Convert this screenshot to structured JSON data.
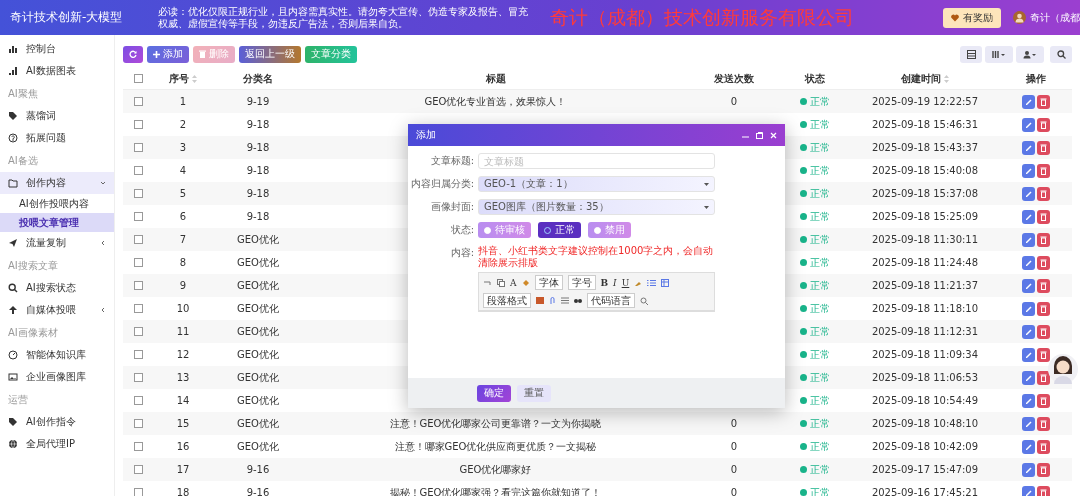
{
  "header": {
    "app_title": "奇计技术创新-大模型",
    "notice": "必读：优化仅限正规行业，且内容需真实性。请勿夸大宣传、伪造专家及报告、冒充权威、虚假宣传等手段，勿违反广告法，否则后果自负。",
    "company_banner": "奇计（成都）技术创新服务有限公司",
    "reward_button": "有奖励",
    "user_name": "奇计（成都"
  },
  "sidebar": {
    "sections": [
      {
        "items": [
          {
            "label": "控制台",
            "selected": false
          },
          {
            "label": "AI数据图表",
            "selected": false
          }
        ]
      },
      {
        "title": "AI聚焦",
        "items": [
          {
            "label": "蒸馏词",
            "selected": false
          },
          {
            "label": "拓展问题",
            "selected": false
          }
        ]
      },
      {
        "title": "AI备选",
        "items": [
          {
            "label": "创作内容",
            "selected": false,
            "expanded": true,
            "children": [
              {
                "label": "AI创作投喂内容",
                "selected": false
              },
              {
                "label": "投喂文章管理",
                "selected": true
              }
            ]
          },
          {
            "label": "流量复制",
            "selected": false,
            "expanded": false
          }
        ]
      },
      {
        "title": "AI搜索文章",
        "items": [
          {
            "label": "AI搜索状态",
            "selected": false
          },
          {
            "label": "自媒体投喂",
            "selected": false,
            "expanded": false
          }
        ]
      },
      {
        "title": "AI画像素材",
        "items": [
          {
            "label": "智能体知识库",
            "selected": false
          },
          {
            "label": "企业画像图库",
            "selected": false
          }
        ]
      },
      {
        "title": "运营",
        "items": [
          {
            "label": "AI创作指令",
            "selected": false
          },
          {
            "label": "全局代理IP",
            "selected": false
          }
        ]
      }
    ]
  },
  "toolbar": {
    "buttons": [
      {
        "kind": "refresh",
        "disabled": false
      },
      {
        "kind": "add",
        "label": "添加",
        "disabled": false
      },
      {
        "kind": "delete",
        "label": "删除",
        "disabled": true
      },
      {
        "kind": "back",
        "label": "返回上一级",
        "disabled": false
      },
      {
        "kind": "category",
        "label": "文章分类",
        "disabled": false
      }
    ]
  },
  "table": {
    "header_checkbox": {
      "checked": false
    },
    "columns": [
      {
        "label": "序号",
        "sortable": true
      },
      {
        "label": "分类名",
        "sortable": false
      },
      {
        "label": "标题",
        "sortable": false
      },
      {
        "label": "发送次数",
        "sortable": false
      },
      {
        "label": "状态",
        "sortable": false
      },
      {
        "label": "创建时间",
        "sortable": true
      },
      {
        "label": "操作",
        "sortable": false
      }
    ],
    "rows": [
      {
        "checked": false,
        "index": "1",
        "category": "9-19",
        "title": "GEO优化专业首选，效果惊人！",
        "send_count": "0",
        "status": "正常",
        "created": "2025-09-19 12:22:57"
      },
      {
        "checked": false,
        "index": "2",
        "category": "9-18",
        "status": "正常",
        "created": "2025-09-18 15:46:31"
      },
      {
        "checked": false,
        "index": "3",
        "category": "9-18",
        "status": "正常",
        "created": "2025-09-18 15:43:37"
      },
      {
        "checked": false,
        "index": "4",
        "category": "9-18",
        "status": "正常",
        "created": "2025-09-18 15:40:08"
      },
      {
        "checked": false,
        "index": "5",
        "category": "9-18",
        "status": "正常",
        "created": "2025-09-18 15:37:08"
      },
      {
        "checked": false,
        "index": "6",
        "category": "9-18",
        "status": "正常",
        "created": "2025-09-18 15:25:09"
      },
      {
        "checked": false,
        "index": "7",
        "category": "GEO优化",
        "status": "正常",
        "created": "2025-09-18 11:30:11"
      },
      {
        "checked": false,
        "index": "8",
        "category": "GEO优化",
        "status": "正常",
        "created": "2025-09-18 11:24:48"
      },
      {
        "checked": false,
        "index": "9",
        "category": "GEO优化",
        "status": "正常",
        "created": "2025-09-18 11:21:37"
      },
      {
        "checked": false,
        "index": "10",
        "category": "GEO优化",
        "status": "正常",
        "created": "2025-09-18 11:18:10"
      },
      {
        "checked": false,
        "index": "11",
        "category": "GEO优化",
        "status": "正常",
        "created": "2025-09-18 11:12:31"
      },
      {
        "checked": false,
        "index": "12",
        "category": "GEO优化",
        "status": "正常",
        "created": "2025-09-18 11:09:34"
      },
      {
        "checked": false,
        "index": "13",
        "category": "GEO优化",
        "status": "正常",
        "created": "2025-09-18 11:06:53"
      },
      {
        "checked": false,
        "index": "14",
        "category": "GEO优化",
        "status": "正常",
        "created": "2025-09-18 10:54:49"
      },
      {
        "checked": false,
        "index": "15",
        "category": "GEO优化",
        "title": "注意！GEO优化哪家公司更靠谱？一文为你揭晓",
        "send_count": "0",
        "status": "正常",
        "created": "2025-09-18 10:48:10"
      },
      {
        "checked": false,
        "index": "16",
        "category": "GEO优化",
        "title": "注意！哪家GEO优化供应商更优质？一文揭秘",
        "send_count": "0",
        "status": "正常",
        "created": "2025-09-18 10:42:09"
      },
      {
        "checked": false,
        "index": "17",
        "category": "9-16",
        "title": "GEO优化哪家好",
        "send_count": "0",
        "status": "正常",
        "created": "2025-09-17 15:47:09"
      },
      {
        "checked": false,
        "index": "18",
        "category": "9-16",
        "title": "揭秘！GEO优化哪家强？看完这篇你就知道了！",
        "send_count": "0",
        "status": "正常",
        "created": "2025-09-16 17:45:21"
      }
    ]
  },
  "dialog": {
    "title": "添加",
    "fields": [
      {
        "kind": "text",
        "label": "文章标题:",
        "placeholder": "文章标题"
      },
      {
        "kind": "select",
        "label": "内容归属分类:",
        "value": "GEO-1（文章：1）"
      },
      {
        "kind": "select",
        "label": "画像封面:",
        "value": "GEO图库（图片数量：35）"
      },
      {
        "kind": "radio",
        "label": "状态:",
        "options": [
          {
            "label": "待审核",
            "selected": false
          },
          {
            "label": "正常",
            "selected": true
          },
          {
            "label": "禁用",
            "selected": false
          }
        ]
      },
      {
        "kind": "editor",
        "label": "内容:",
        "hint": "抖音、小红书类文字建议控制在1000字之内，会自动清除展示排版",
        "font_color_key": "A",
        "font": "字体",
        "size": "字号",
        "format_keys": [
          "B",
          "I",
          "U"
        ],
        "paragraph": "段落格式",
        "code_language": "代码语言"
      }
    ],
    "buttons": [
      {
        "kind": "primary",
        "label": "确定"
      },
      {
        "kind": "reset",
        "label": "重置"
      }
    ]
  }
}
